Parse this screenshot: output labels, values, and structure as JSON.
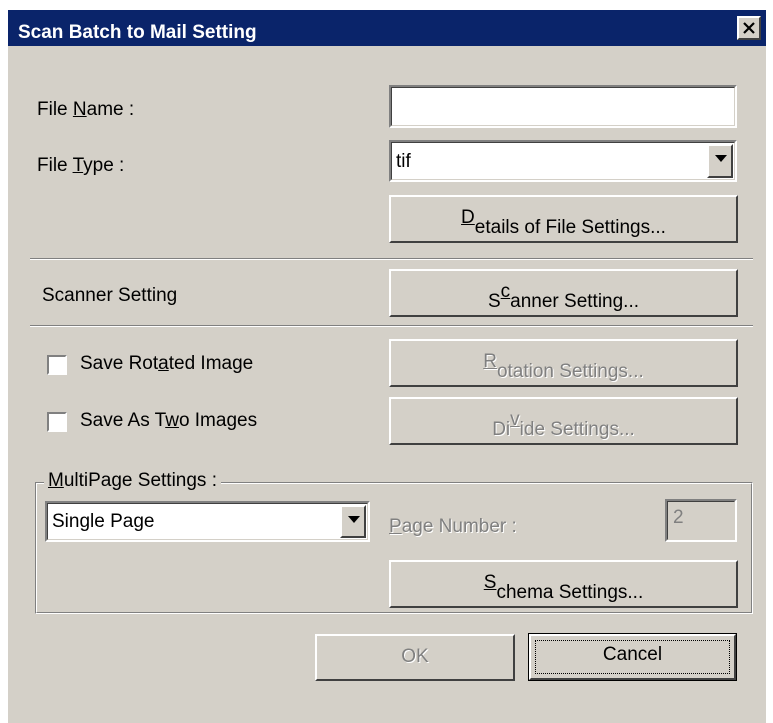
{
  "window": {
    "title": "Scan Batch to Mail Setting",
    "close_icon": "close-icon"
  },
  "file_name": {
    "label_pre": "File ",
    "label_ul": "N",
    "label_post": "ame :",
    "value": ""
  },
  "file_type": {
    "label_pre": "File ",
    "label_ul": "T",
    "label_post": "ype :",
    "value": "tif",
    "options_visible": [
      "tif"
    ]
  },
  "details_button": {
    "pre": "",
    "ul": "D",
    "post": "etails of File Settings..."
  },
  "scanner": {
    "label": "Scanner Setting",
    "button_pre": "S",
    "button_ul": "c",
    "button_post": "anner Setting..."
  },
  "rotate": {
    "checked": false,
    "label_pre": "Save Rot",
    "label_ul": "a",
    "label_post": "ted Image",
    "button_pre": "",
    "button_ul": "R",
    "button_post": "otation Settings..."
  },
  "two_images": {
    "checked": false,
    "label_pre": "Save As T",
    "label_ul": "w",
    "label_post": "o Images",
    "button_pre": "Di",
    "button_ul": "v",
    "button_post": "ide Settings..."
  },
  "multipage": {
    "group_pre": "",
    "group_ul": "M",
    "group_post": "ultiPage Settings :",
    "mode": "Single Page",
    "page_number_pre": "",
    "page_number_ul": "P",
    "page_number_post": "age Number :",
    "page_number_value": "2",
    "schema_pre": "",
    "schema_ul": "S",
    "schema_post": "chema Settings..."
  },
  "footer": {
    "ok": "OK",
    "cancel": "Cancel"
  },
  "colors": {
    "title_bar": "#0a246a",
    "face": "#d4d0c8",
    "disabled_text": "#808080"
  }
}
